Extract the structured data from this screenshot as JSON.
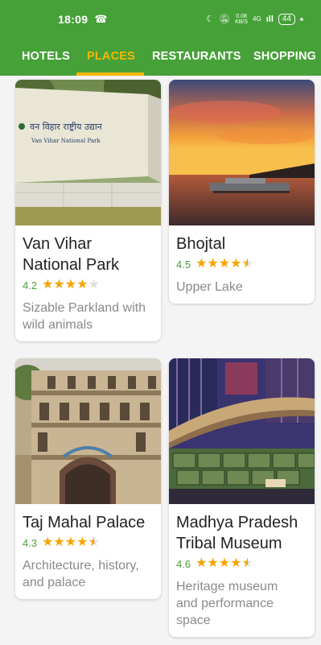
{
  "status_bar": {
    "time": "18:09",
    "network_speed": "0.08\nKB/S",
    "signal_text": "4G",
    "battery": "44"
  },
  "tabs": [
    {
      "label": "HOTELS",
      "active": false
    },
    {
      "label": "PLACES",
      "active": true
    },
    {
      "label": "RESTAURANTS",
      "active": false
    },
    {
      "label": "SHOPPING",
      "active": false
    }
  ],
  "colors": {
    "app_bar": "#46a138",
    "active_tab": "#f5b800",
    "rating_text": "#4c9e3c",
    "star": "#f5a400"
  },
  "places": [
    {
      "name": "Van Vihar\nNational Park",
      "rating_text": "4.2",
      "rating": 4.2,
      "description": "Sizable Parkland with\nwild animals",
      "sign_text_1": "वन विहार राष्ट्रीय उद्यान",
      "sign_text_2": "Van Vihar National Park"
    },
    {
      "name": "Bhojtal",
      "rating_text": "4.5",
      "rating": 4.5,
      "description": "Upper Lake"
    },
    {
      "name": "Taj Mahal Palace",
      "rating_text": "4.3",
      "rating": 4.3,
      "description": "Architecture, history,\nand palace"
    },
    {
      "name": "Madhya Pradesh\nTribal Museum",
      "rating_text": "4.6",
      "rating": 4.6,
      "description": "Heritage museum\nand performance\nspace"
    }
  ]
}
